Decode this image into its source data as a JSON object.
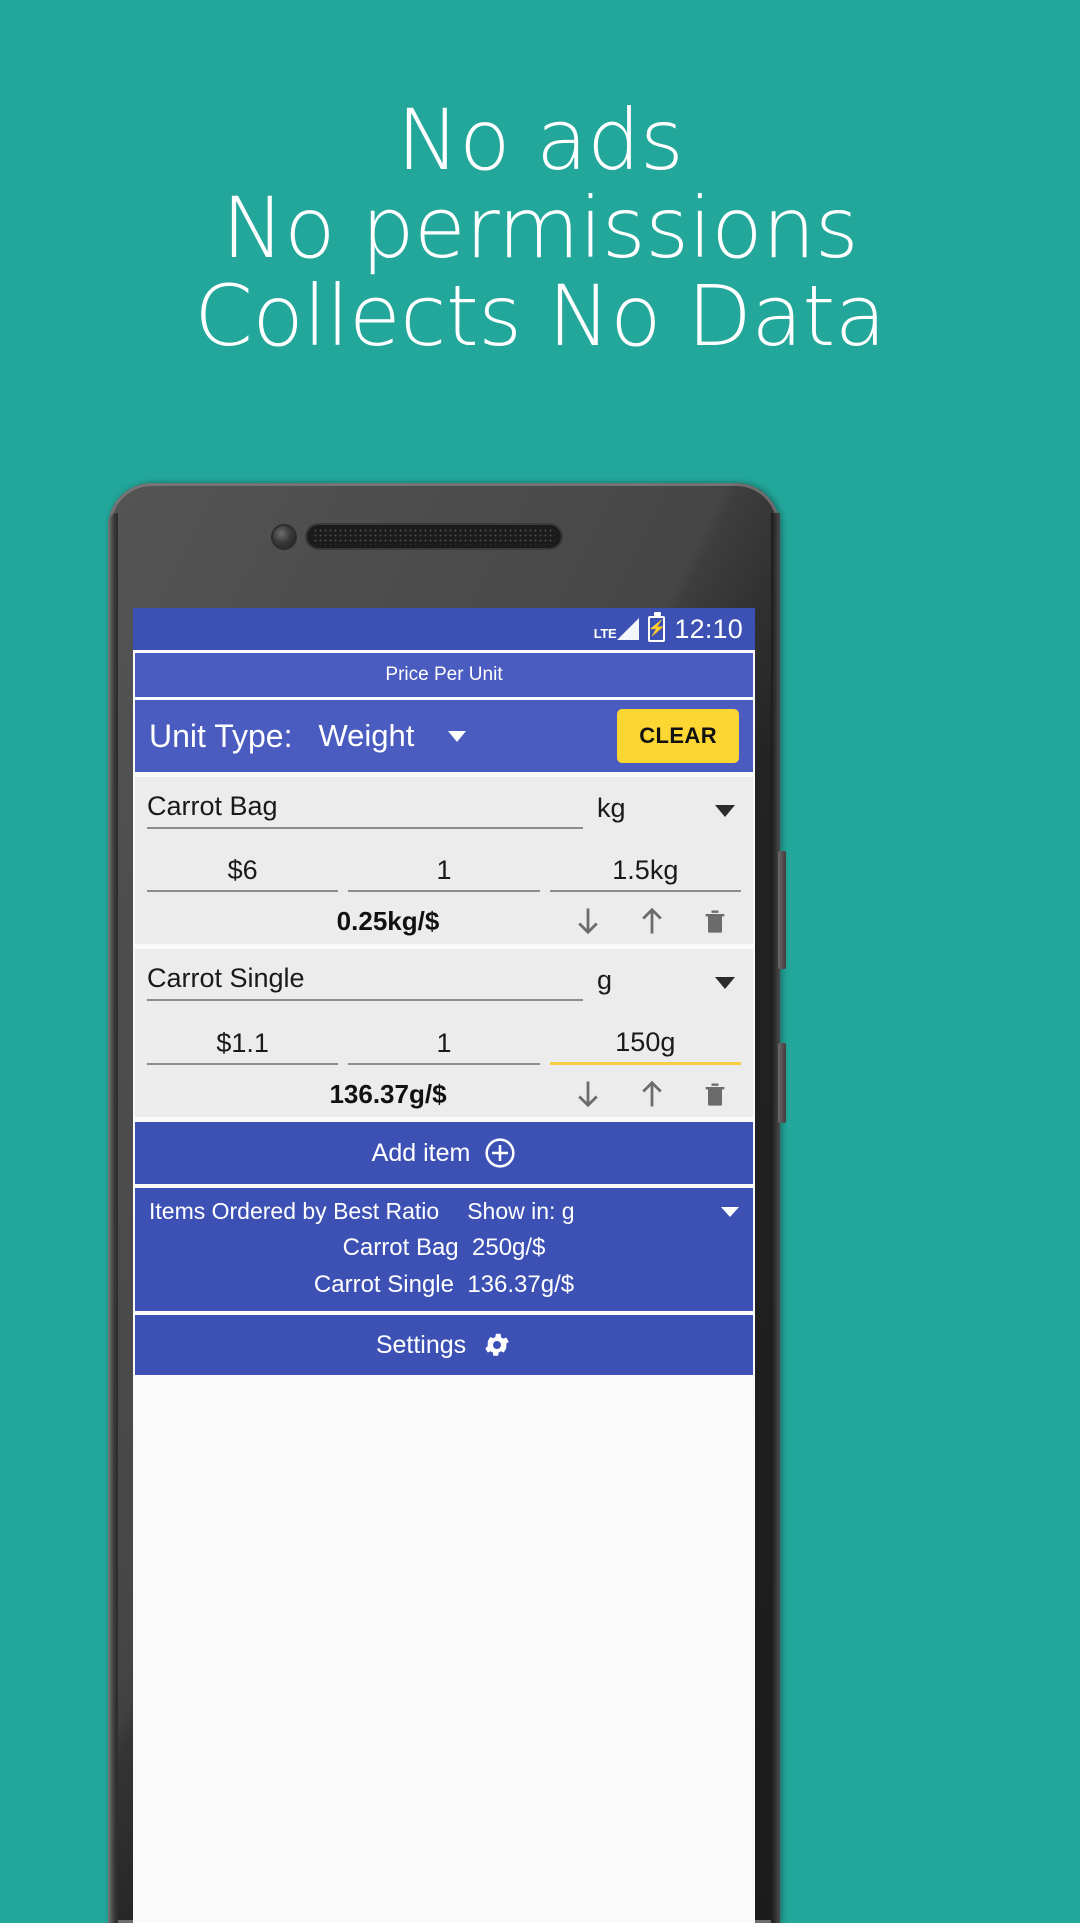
{
  "promo": {
    "lines": [
      "No ads",
      "No permissions",
      "Collects No Data"
    ],
    "background_color": "#23a79b",
    "text_color": "#ffffff"
  },
  "colors": {
    "primary_blue": "#3d51b5",
    "light_blue": "#4b5cc0",
    "accent_yellow": "#fcd733",
    "card_grey": "#ececec",
    "focus_underline": "#f5cf3f"
  },
  "status_bar": {
    "network": "LTE",
    "signal_icon": "signal-bars-icon",
    "battery_icon": "battery-charging-icon",
    "time": "12:10"
  },
  "app": {
    "title": "Price Per Unit",
    "unit_type": {
      "label": "Unit Type:",
      "value": "Weight",
      "dropdown_icon": "chevron-down-icon"
    },
    "clear_label": "CLEAR"
  },
  "items": [
    {
      "name": "Carrot Bag",
      "unit": "kg",
      "price": "$6",
      "quantity": "1",
      "amount": "1.5kg",
      "ratio": "0.25kg/$",
      "amount_focused": false
    },
    {
      "name": "Carrot Single",
      "unit": "g",
      "price": "$1.1",
      "quantity": "1",
      "amount": "150g",
      "ratio": "136.37g/$",
      "amount_focused": true
    }
  ],
  "add_item": {
    "label": "Add item",
    "icon": "plus-circle-icon"
  },
  "ordered_panel": {
    "title": "Items Ordered by Best Ratio",
    "show_in_label": "Show in:",
    "show_in_value": "g",
    "dropdown_icon": "chevron-down-icon",
    "rows": [
      {
        "name": "Carrot Bag",
        "ratio": "250g/$"
      },
      {
        "name": "Carrot Single",
        "ratio": "136.37g/$"
      }
    ]
  },
  "settings": {
    "label": "Settings",
    "icon": "gear-icon"
  },
  "row_icons": {
    "down": "arrow-down-icon",
    "up": "arrow-up-icon",
    "delete": "trash-icon"
  }
}
